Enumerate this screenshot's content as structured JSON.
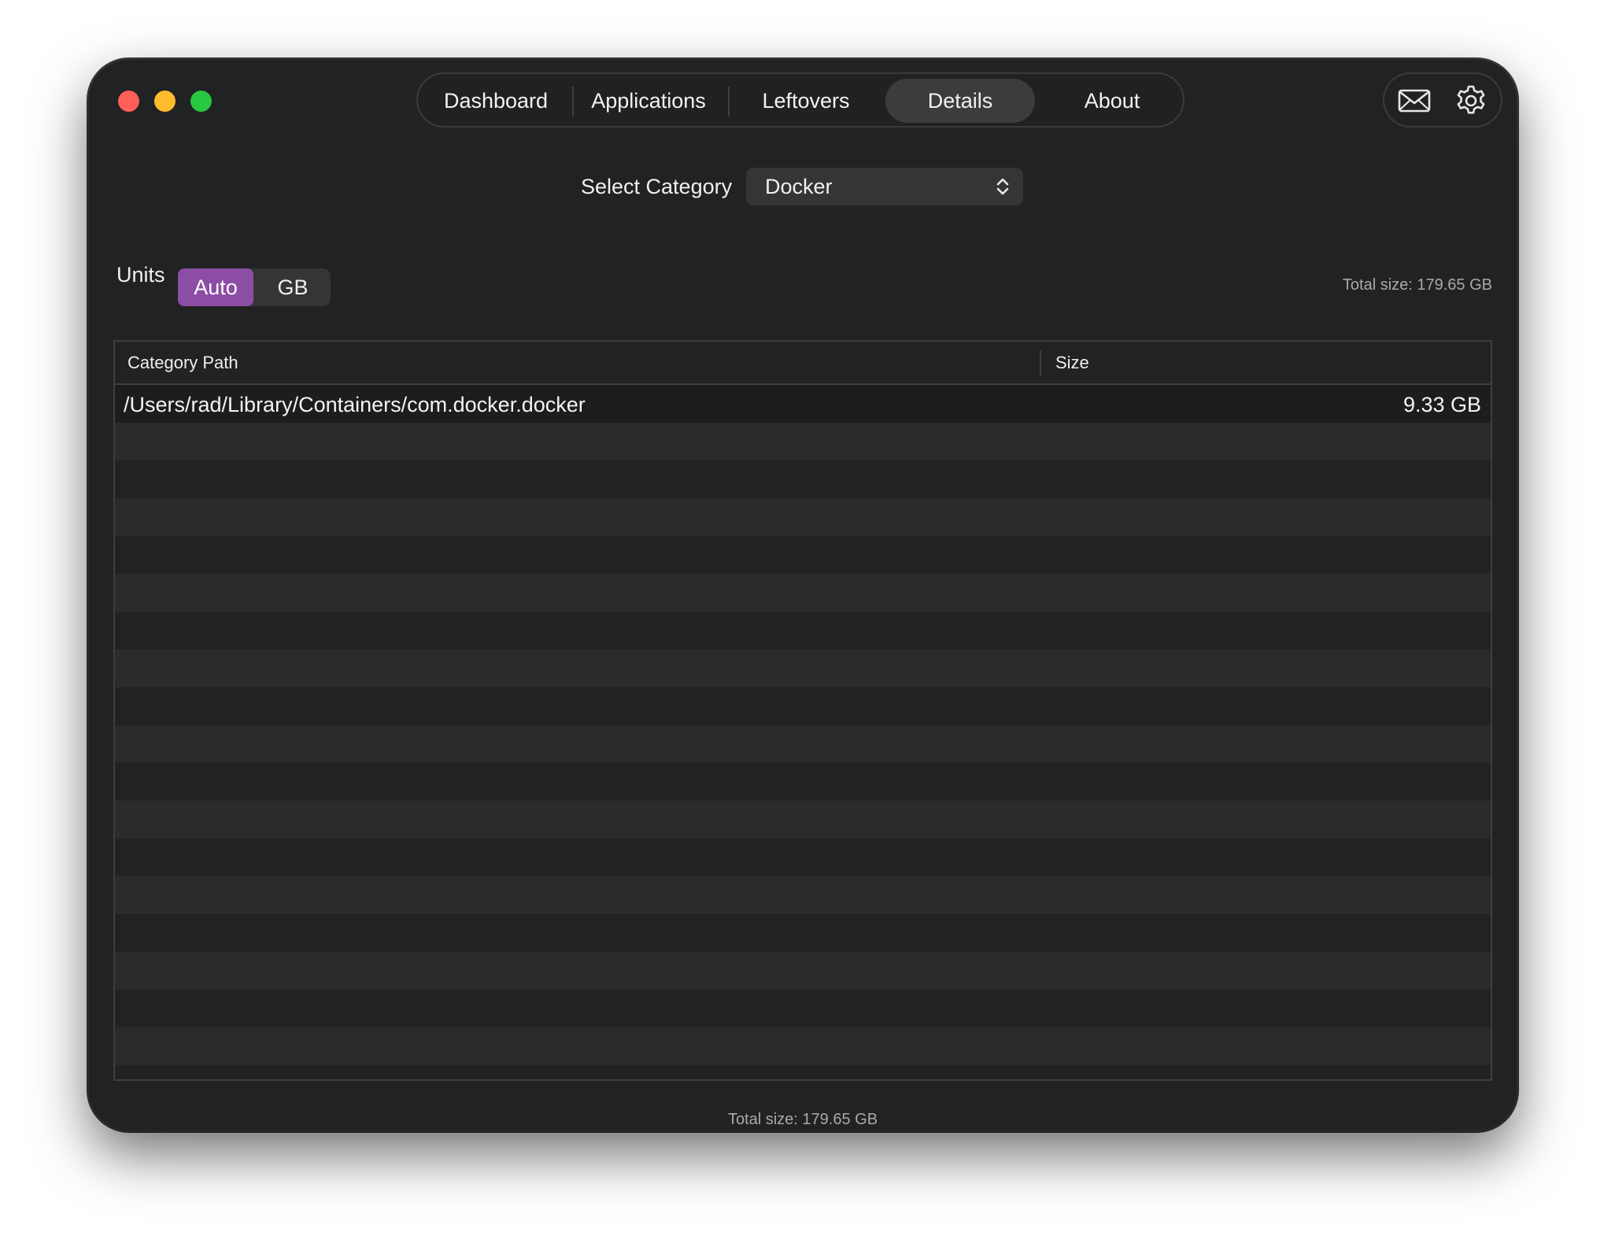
{
  "window": {
    "traffic_lights": [
      "close",
      "minimize",
      "zoom"
    ]
  },
  "tabs": [
    {
      "label": "Dashboard",
      "active": false
    },
    {
      "label": "Applications",
      "active": false
    },
    {
      "label": "Leftovers",
      "active": false
    },
    {
      "label": "Details",
      "active": true
    },
    {
      "label": "About",
      "active": false
    }
  ],
  "toolbar_icons": [
    "envelope-icon",
    "gear-icon"
  ],
  "category": {
    "label": "Select Category",
    "selected": "Docker"
  },
  "units": {
    "label": "Units",
    "options": [
      "Auto",
      "GB"
    ],
    "selected": "Auto"
  },
  "total_top": "Total size: 179.65 GB",
  "table": {
    "columns": [
      "Category Path",
      "Size"
    ],
    "rows": [
      {
        "path": "/Users/rad/Library/Containers/com.docker.docker",
        "size": "9.33 GB"
      }
    ]
  },
  "total_bottom": "Total size: 179.65 GB",
  "colors": {
    "accent": "#8b4ea4",
    "window_bg": "#212223",
    "close": "#ff5f57",
    "minimize": "#febc2e",
    "zoom": "#28c840"
  }
}
